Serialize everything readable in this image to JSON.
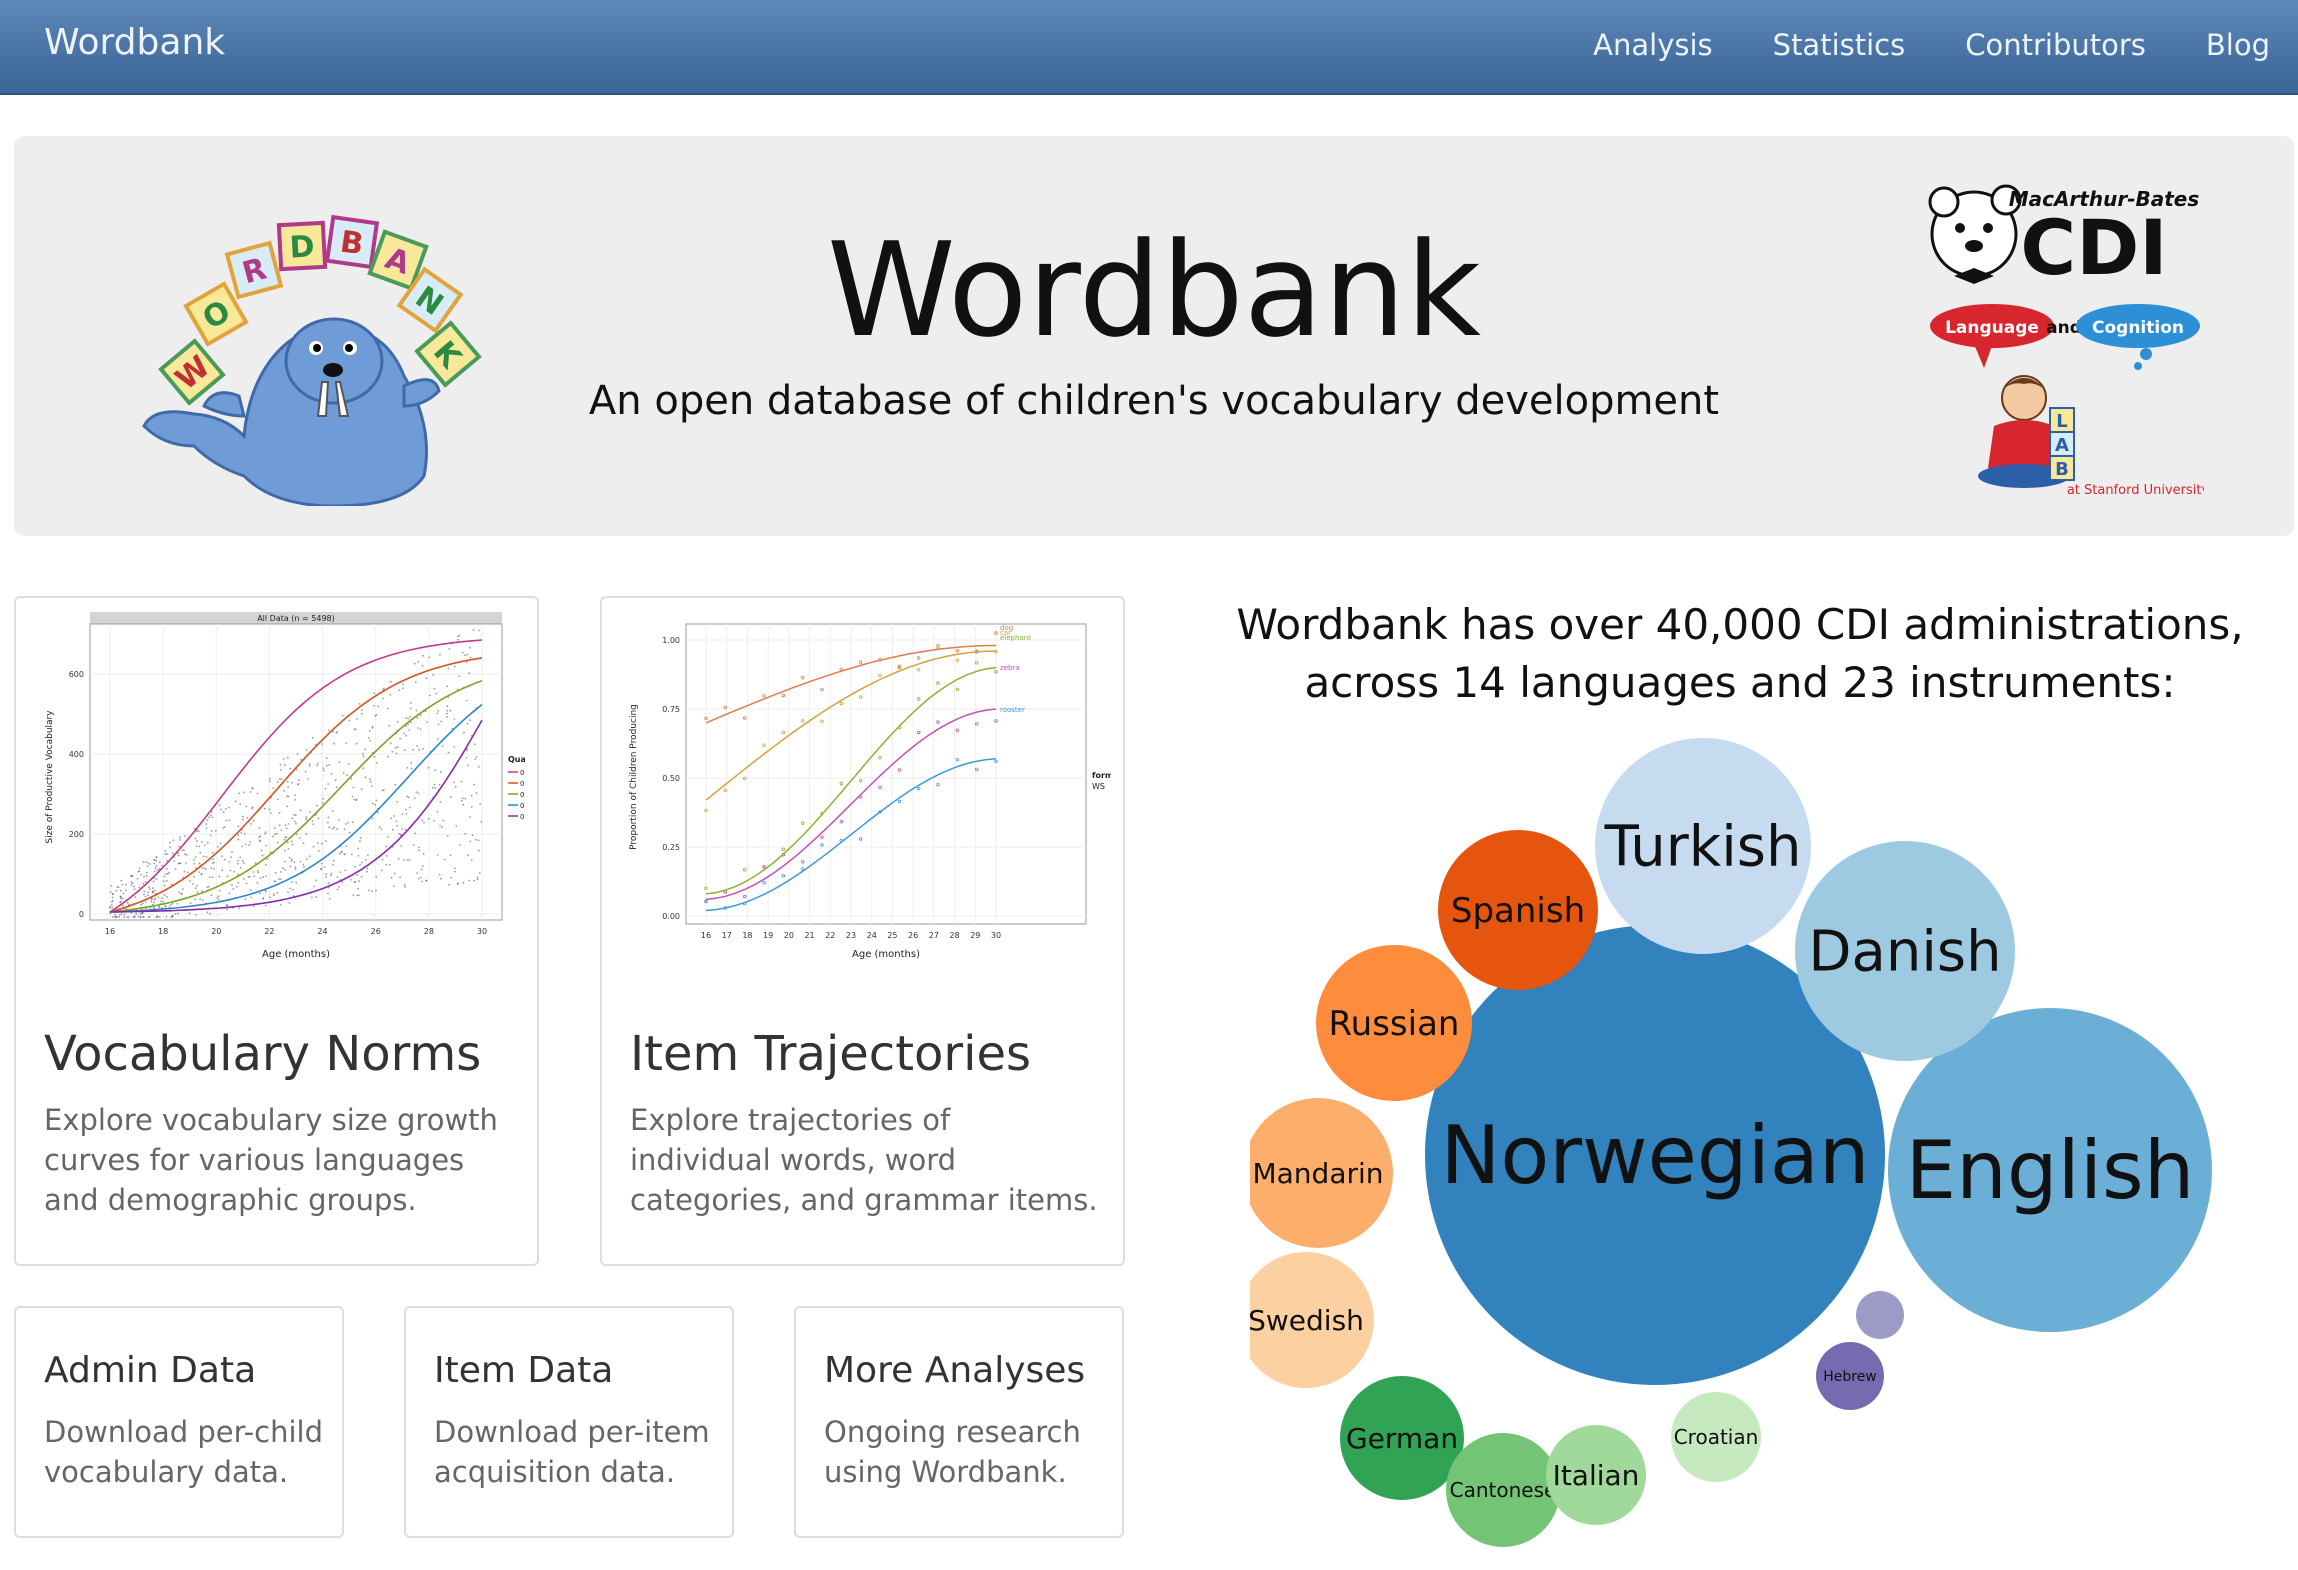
{
  "navbar": {
    "brand": "Wordbank",
    "links": [
      "Analysis",
      "Statistics",
      "Contributors",
      "Blog"
    ]
  },
  "hero": {
    "title": "Wordbank",
    "subtitle": "An open database of children's vocabulary development",
    "logo_blocks": [
      "W",
      "O",
      "R",
      "D",
      "B",
      "A",
      "N",
      "K"
    ],
    "logo_right": {
      "top_script": "MacArthur-Bates",
      "big": "CDI",
      "bubble_left": "Language",
      "and": "and",
      "bubble_right": "Cognition",
      "lab_blocks": [
        "L",
        "A",
        "B"
      ],
      "affiliation": "at Stanford University"
    }
  },
  "cards": {
    "vocab": {
      "title": "Vocabulary Norms",
      "text": "Explore vocabulary size growth curves for various languages and demographic groups."
    },
    "items": {
      "title": "Item Trajectories",
      "text": "Explore trajectories of individual words, word categories, and grammar items."
    },
    "admin": {
      "title": "Admin Data",
      "text": "Download per-child vocabulary data."
    },
    "itemdata": {
      "title": "Item Data",
      "text": "Download per-item acquisition data."
    },
    "more": {
      "title": "More Analyses",
      "text": "Ongoing research using Wordbank."
    }
  },
  "thumb_vocab": {
    "panel_title": "All Data (n = 5498)",
    "ylabel": "Size of Productive Vocabulary",
    "xlabel": "Age (months)",
    "yticks": [
      "0",
      "200",
      "400",
      "600"
    ],
    "xticks": [
      "16",
      "18",
      "20",
      "22",
      "24",
      "26",
      "28",
      "30"
    ],
    "legend_title": "Quantile",
    "legend": [
      {
        "label": "0.90",
        "color": "#c23a8a"
      },
      {
        "label": "0.75",
        "color": "#d8531e"
      },
      {
        "label": "0.50",
        "color": "#7aa51f"
      },
      {
        "label": "0.25",
        "color": "#2d86cc"
      },
      {
        "label": "0.10",
        "color": "#8a2aa8"
      }
    ]
  },
  "thumb_items": {
    "ylabel": "Proportion of Children Producing",
    "xlabel": "Age (months)",
    "yticks": [
      "0.00",
      "0.25",
      "0.50",
      "0.75",
      "1.00"
    ],
    "xticks": [
      "16",
      "17",
      "18",
      "19",
      "20",
      "21",
      "22",
      "23",
      "24",
      "25",
      "26",
      "27",
      "28",
      "29",
      "30"
    ],
    "legend_title": "form",
    "legend_item": "WS",
    "words": [
      {
        "label": "dog",
        "color": "#e07b4f"
      },
      {
        "label": "car",
        "color": "#d7a13c"
      },
      {
        "label": "elephant",
        "color": "#8fb22c"
      },
      {
        "label": "zebra",
        "color": "#c252b8"
      },
      {
        "label": "rooster",
        "color": "#3a9bd8"
      }
    ]
  },
  "stats": {
    "heading_line1": "Wordbank has over 40,000 CDI administrations,",
    "heading_line2": "across 14 languages and 23 instruments:"
  },
  "bubbles": [
    {
      "label": "Norwegian",
      "color": "#3182bd"
    },
    {
      "label": "English",
      "color": "#6baed6"
    },
    {
      "label": "Danish",
      "color": "#9ecae1"
    },
    {
      "label": "Turkish",
      "color": "#c6dbef"
    },
    {
      "label": "Spanish",
      "color": "#e6550d"
    },
    {
      "label": "Russian",
      "color": "#fd8d3c"
    },
    {
      "label": "Mandarin",
      "color": "#fdae6b"
    },
    {
      "label": "Swedish",
      "color": "#fdd0a2"
    },
    {
      "label": "German",
      "color": "#31a354"
    },
    {
      "label": "Cantonese",
      "color": "#74c476"
    },
    {
      "label": "Italian",
      "color": "#a1d99b"
    },
    {
      "label": "Croatian",
      "color": "#c7e9c0"
    },
    {
      "label": "Hebrew",
      "color": "#756bb1"
    },
    {
      "label": "",
      "color": "#9e9ac8"
    }
  ]
}
